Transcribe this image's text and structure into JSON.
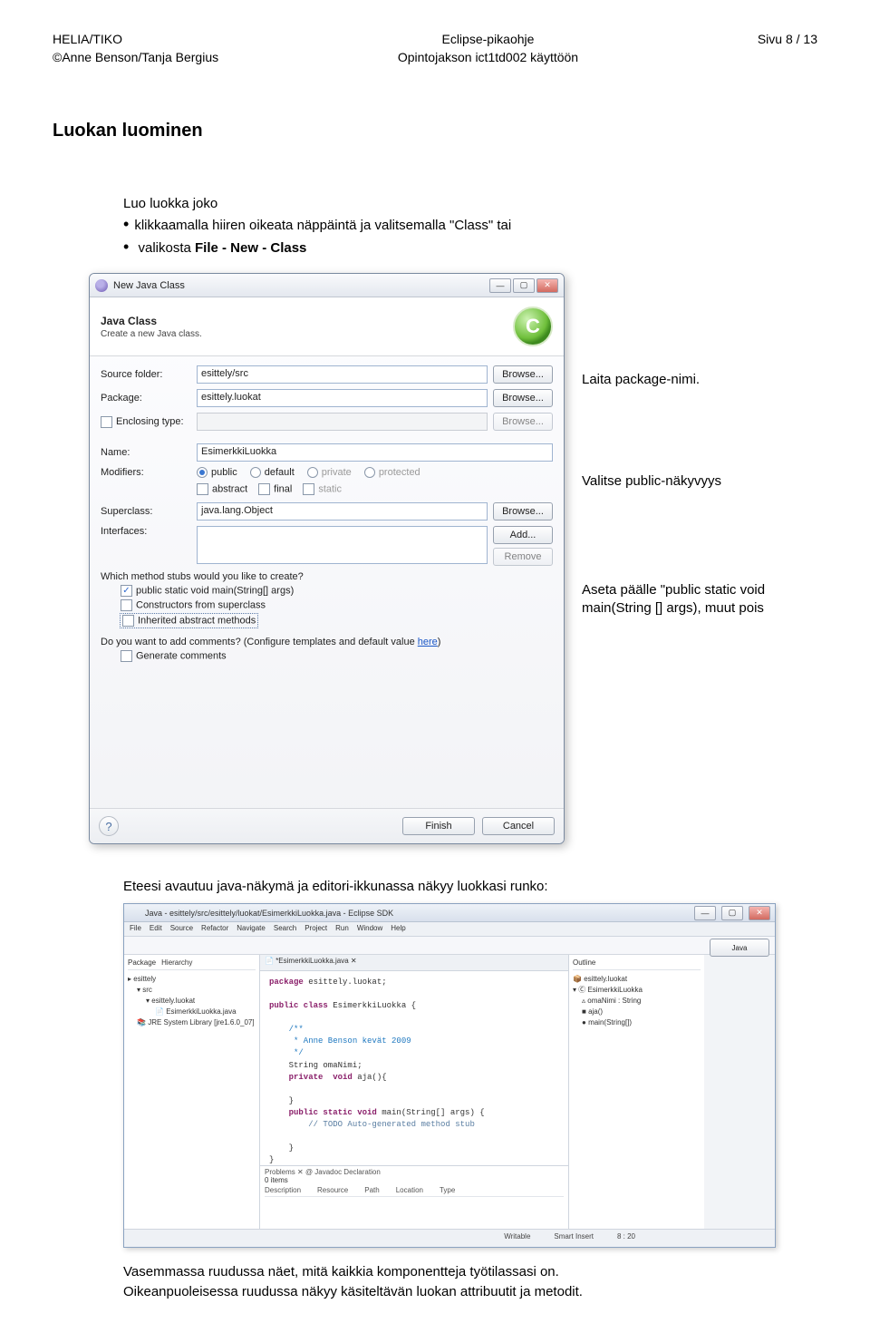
{
  "header": {
    "left1": "HELIA/TIKO",
    "left2": "©Anne Benson/Tanja Bergius",
    "center1": "Eclipse-pikaohje",
    "center2": "Opintojakson ict1td002 käyttöön",
    "right": "Sivu 8 / 13"
  },
  "title": "Luokan luominen",
  "intro": {
    "lead": "Luo luokka joko",
    "bullet1": "klikkaamalla hiiren oikeata näppäintä ja valitsemalla \"Class\" tai",
    "bullet2_a": "valikosta ",
    "bullet2_b": "File - New - Class"
  },
  "callouts": {
    "c1": "Laita package-nimi.",
    "c2": "Valitse public-näkyvyys",
    "c3": "Aseta päälle \"public static void main(String [] args), muut pois"
  },
  "dialog": {
    "title": "New Java Class",
    "banner_title": "Java Class",
    "banner_desc": "Create a new Java class.",
    "labels": {
      "srcfolder": "Source folder:",
      "pkg": "Package:",
      "encl": "Enclosing type:",
      "name": "Name:",
      "mods": "Modifiers:",
      "superclass": "Superclass:",
      "interfaces": "Interfaces:"
    },
    "values": {
      "srcfolder": "esittely/src",
      "pkg": "esittely.luokat",
      "name": "EsimerkkiLuokka",
      "superclass": "java.lang.Object"
    },
    "buttons": {
      "browse_src": "Browse...",
      "browse_pkg": "Browse...",
      "browse_encl": "Browse...",
      "browse_super": "Browse...",
      "add": "Add...",
      "remove": "Remove",
      "finish": "Finish",
      "cancel": "Cancel"
    },
    "modifiers": {
      "public": "public",
      "default": "default",
      "private": "private",
      "protected": "protected",
      "abstract": "abstract",
      "final": "final",
      "static": "static"
    },
    "stubs_q": "Which method stubs would you like to create?",
    "stubs": {
      "main": "public static void main(String[] args)",
      "ctors": "Constructors from superclass",
      "inherited": "Inherited abstract methods"
    },
    "comments_q_a": "Do you want to add comments? (Configure templates and default value ",
    "comments_q_b": "here",
    "comments_q_c": ")",
    "gen_comments": "Generate comments"
  },
  "mid_text": "Eteesi avautuu java-näkymä ja editori-ikkunassa näkyy luokkasi runko:",
  "ide": {
    "title": "Java - esittely/src/esittely/luokat/EsimerkkiLuokka.java - Eclipse SDK",
    "menu": [
      "File",
      "Edit",
      "Source",
      "Refactor",
      "Navigate",
      "Search",
      "Project",
      "Run",
      "Window",
      "Help"
    ],
    "left_tabs": [
      "Package",
      "Hierarchy"
    ],
    "proj": "esittely",
    "src": "src",
    "pkg": "esittely.luokat",
    "file": "EsimerkkiLuokka.java",
    "jre": "JRE System Library [jre1.6.0_07]",
    "editor_tab": "*EsimerkkiLuokka.java",
    "outline_label": "Outline",
    "outline_pkg": "esittely.luokat",
    "outline_cls": "EsimerkkiLuokka",
    "outline_fld": "omaNimi : String",
    "outline_m1": "aja()",
    "outline_m2": "main(String[])",
    "code": {
      "l1": "package esittely.luokat;",
      "l2": "public class EsimerkkiLuokka {",
      "l3": "    /**",
      "l4": "     * Anne Benson kevät 2009",
      "l5": "     */",
      "l6": "    String omaNimi;",
      "l7": "    private void aja(){",
      "l8": "",
      "l9": "    }",
      "l10": "    public static void main(String[] args) {",
      "l11": "        // TODO Auto-generated method stub",
      "l12": "",
      "l13": "    }",
      "l14": "}"
    },
    "problems": {
      "tabs": "Problems ✕   @ Javadoc   Declaration",
      "items": "0 items",
      "cols": [
        "Description",
        "Resource",
        "Path",
        "Location",
        "Type"
      ]
    },
    "status": {
      "writable": "Writable",
      "insert": "Smart Insert",
      "pos": "8 : 20"
    },
    "java_btn": "Java"
  },
  "bottom": {
    "l1": "Vasemmassa ruudussa näet, mitä kaikkia komponentteja työtilassasi on.",
    "l2": "Oikeanpuoleisessa ruudussa näkyy käsiteltävän luokan attribuutit ja metodit."
  }
}
